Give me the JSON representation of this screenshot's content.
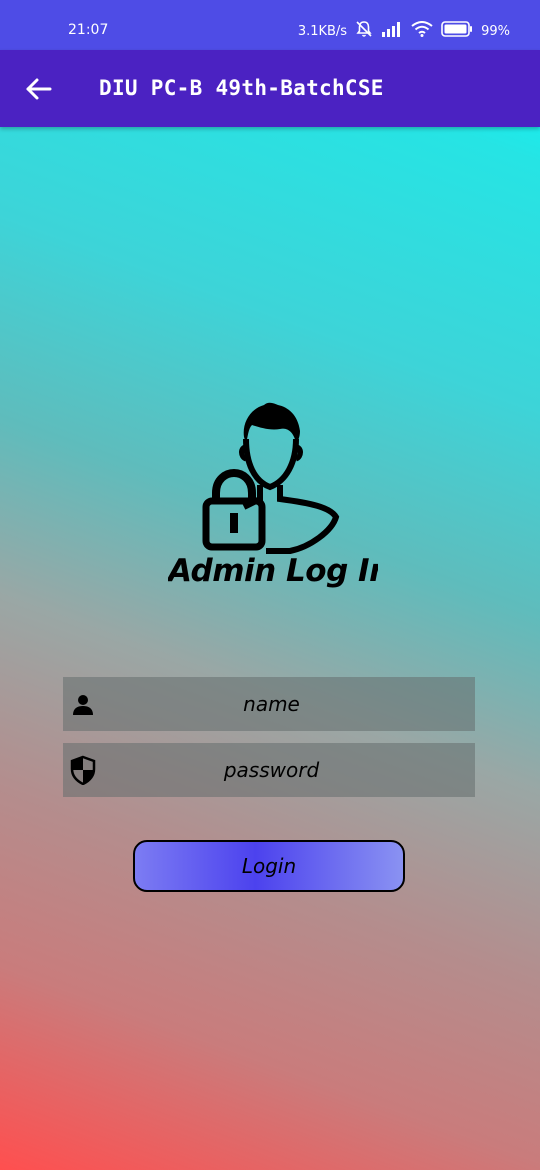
{
  "status_bar": {
    "time": "21:07",
    "network_speed": "3.1KB/s",
    "battery": "99%",
    "icons": [
      "mute-icon",
      "signal-icon",
      "wifi-icon",
      "battery-icon"
    ]
  },
  "app_bar": {
    "title": "DIU PC-B 49th-BatchCSE",
    "back_icon": "back-arrow-icon"
  },
  "logo": {
    "caption": "Admin Log In",
    "icon": "admin-lock-icon"
  },
  "form": {
    "name_placeholder": "name",
    "password_placeholder": "password",
    "name_icon": "person-icon",
    "password_icon": "shield-icon",
    "login_label": "Login"
  },
  "colors": {
    "status_bar": "#4e4ce6",
    "app_bar": "#4b22c2",
    "gradient_top": "#00ffff",
    "gradient_bottom": "#ff4f4f",
    "button_accent": "#4c42ee"
  }
}
